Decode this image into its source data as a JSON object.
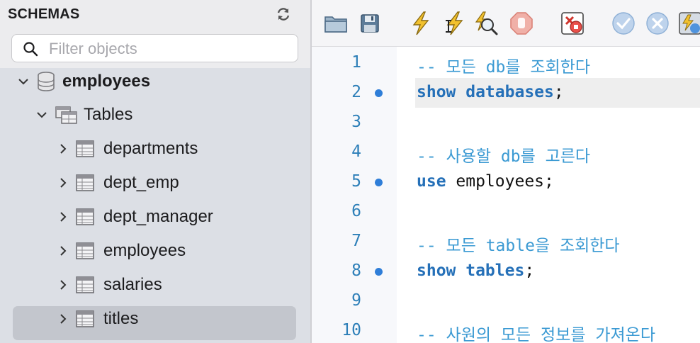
{
  "schemas_panel": {
    "title": "SCHEMAS",
    "refresh_icon": "refresh-icon",
    "filter": {
      "placeholder": "Filter objects",
      "value": "",
      "icon": "search-icon"
    },
    "tree": {
      "database": {
        "label": "employees",
        "expanded": true,
        "icon": "database-icon"
      },
      "tables_folder": {
        "label": "Tables",
        "expanded": true,
        "icon": "tables-folder-icon"
      },
      "tables": [
        {
          "label": "departments",
          "selected": false
        },
        {
          "label": "dept_emp",
          "selected": false
        },
        {
          "label": "dept_manager",
          "selected": false
        },
        {
          "label": "employees",
          "selected": false
        },
        {
          "label": "salaries",
          "selected": false
        },
        {
          "label": "titles",
          "selected": true
        }
      ]
    }
  },
  "toolbar": {
    "buttons": [
      {
        "name": "open-file",
        "icon": "folder-icon"
      },
      {
        "name": "save",
        "icon": "floppy-disk-icon"
      },
      {
        "name": "execute",
        "icon": "lightning-icon"
      },
      {
        "name": "execute-current",
        "icon": "lightning-cursor-icon"
      },
      {
        "name": "explain",
        "icon": "magnifier-icon"
      },
      {
        "name": "stop",
        "icon": "stop-hand-icon"
      },
      {
        "name": "toggle-stop-on-error",
        "icon": "stop-on-error-icon"
      },
      {
        "name": "commit",
        "icon": "checkmark-icon"
      },
      {
        "name": "rollback",
        "icon": "x-circle-icon"
      },
      {
        "name": "autocommit",
        "icon": "autocommit-icon"
      }
    ]
  },
  "editor": {
    "current_line": 2,
    "lines": [
      {
        "number": "1",
        "breakpoint": false,
        "tokens": [
          {
            "t": "cm",
            "v": "-- 모든 db를 조회한다"
          }
        ]
      },
      {
        "number": "2",
        "breakpoint": true,
        "tokens": [
          {
            "t": "kw",
            "v": "show databases"
          },
          {
            "t": "plain",
            "v": ";"
          }
        ]
      },
      {
        "number": "3",
        "breakpoint": false,
        "tokens": []
      },
      {
        "number": "4",
        "breakpoint": false,
        "tokens": [
          {
            "t": "cm",
            "v": "-- 사용할 db를 고른다"
          }
        ]
      },
      {
        "number": "5",
        "breakpoint": true,
        "tokens": [
          {
            "t": "kw",
            "v": "use"
          },
          {
            "t": "plain",
            "v": " employees;"
          }
        ]
      },
      {
        "number": "6",
        "breakpoint": false,
        "tokens": []
      },
      {
        "number": "7",
        "breakpoint": false,
        "tokens": [
          {
            "t": "cm",
            "v": "-- 모든 table을 조회한다"
          }
        ]
      },
      {
        "number": "8",
        "breakpoint": true,
        "tokens": [
          {
            "t": "kw",
            "v": "show tables"
          },
          {
            "t": "plain",
            "v": ";"
          }
        ]
      },
      {
        "number": "9",
        "breakpoint": false,
        "tokens": []
      },
      {
        "number": "10",
        "breakpoint": false,
        "tokens": [
          {
            "t": "cm",
            "v": "-- 사원의 모든 정보를 가져온다"
          }
        ]
      }
    ]
  },
  "colors": {
    "keyword": "#2570b8",
    "comment": "#3b9ad3",
    "line_number": "#2d7fb8",
    "breakpoint": "#2f7ed8",
    "selection": "#c3c6cd",
    "panel_bg": "#dcdfe5"
  }
}
